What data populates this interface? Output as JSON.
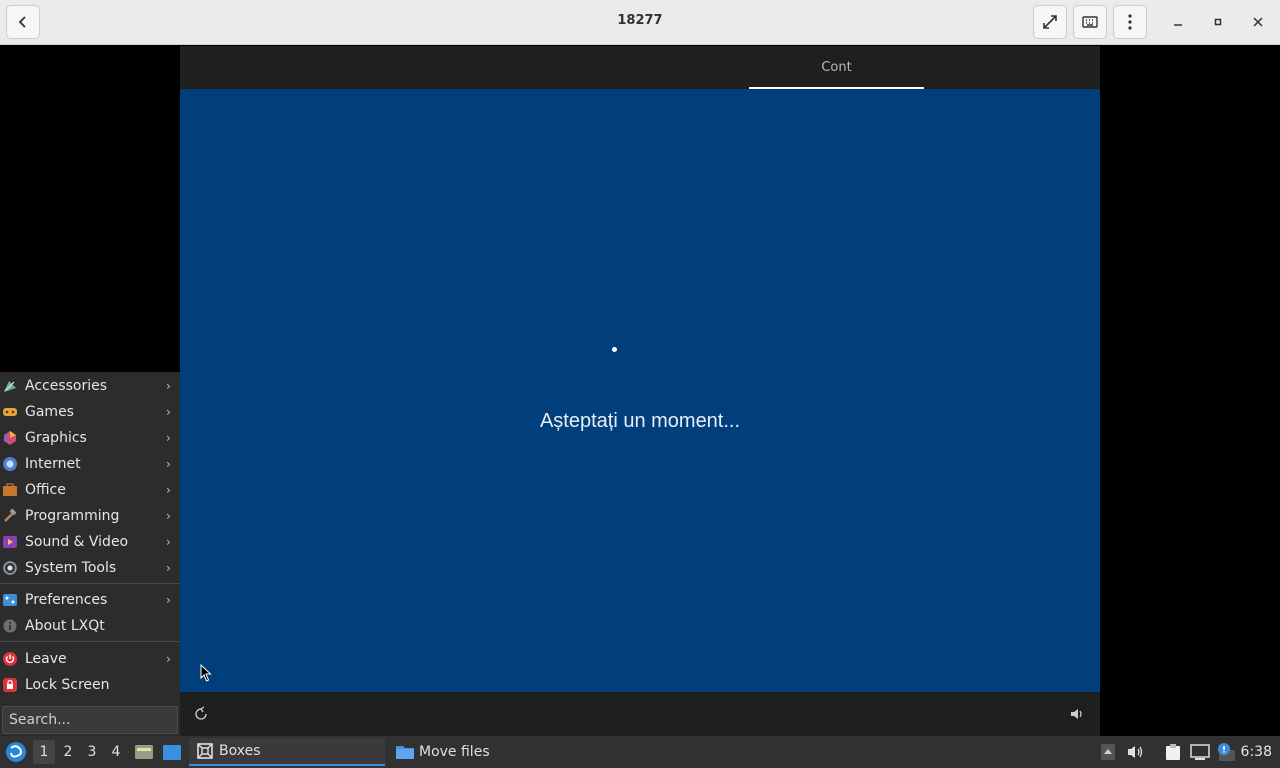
{
  "window": {
    "title": "18277",
    "icons": {
      "back": "back-arrow-icon",
      "fullscreen": "fullscreen-icon",
      "keyboard": "keyboard-icon",
      "menu": "vertical-dots-icon",
      "minimize": "minimize-icon",
      "maximize": "maximize-icon",
      "close": "close-icon"
    }
  },
  "guest": {
    "tab_label": "Cont",
    "wait_message": "Așteptați un moment...",
    "colors": {
      "background": "#003f7b",
      "header": "#1f1f1f"
    }
  },
  "start_menu": {
    "items": [
      {
        "label": "Accessories",
        "icon": "accessories-icon",
        "submenu": true
      },
      {
        "label": "Games",
        "icon": "games-icon",
        "submenu": true
      },
      {
        "label": "Graphics",
        "icon": "graphics-icon",
        "submenu": true
      },
      {
        "label": "Internet",
        "icon": "internet-icon",
        "submenu": true
      },
      {
        "label": "Office",
        "icon": "office-icon",
        "submenu": true
      },
      {
        "label": "Programming",
        "icon": "programming-icon",
        "submenu": true
      },
      {
        "label": "Sound & Video",
        "icon": "sound-video-icon",
        "submenu": true
      },
      {
        "label": "System Tools",
        "icon": "system-tools-icon",
        "submenu": true
      },
      {
        "label": "Preferences",
        "icon": "preferences-icon",
        "submenu": true
      },
      {
        "label": "About LXQt",
        "icon": "info-icon",
        "submenu": false
      },
      {
        "label": "Leave",
        "icon": "power-icon",
        "submenu": true
      },
      {
        "label": "Lock Screen",
        "icon": "lock-icon",
        "submenu": false
      }
    ],
    "search_placeholder": "Search..."
  },
  "taskbar": {
    "workspaces": [
      "1",
      "2",
      "3",
      "4"
    ],
    "active_workspace": "1",
    "tasks": [
      {
        "label": "Boxes",
        "icon": "boxes-icon",
        "active": true
      },
      {
        "label": "Move files",
        "icon": "folder-icon",
        "active": false
      }
    ],
    "clock": "6:38"
  }
}
